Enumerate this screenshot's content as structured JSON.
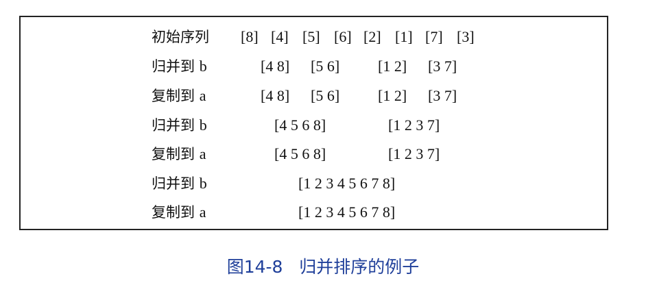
{
  "rows": [
    {
      "label": "初始序列",
      "label_latin": "",
      "groups": [
        "[8]",
        "[4]",
        "[5]",
        "[6]",
        "[2]",
        "[1]",
        "[7]",
        "[3]"
      ]
    },
    {
      "label": "归并到",
      "label_latin": "b",
      "groups": [
        "[4 8]",
        "[5 6]",
        "[1 2]",
        "[3 7]"
      ]
    },
    {
      "label": "复制到",
      "label_latin": "a",
      "groups": [
        "[4 8]",
        "[5 6]",
        "[1 2]",
        "[3 7]"
      ]
    },
    {
      "label": "归并到",
      "label_latin": "b",
      "groups": [
        "[4 5 6 8]",
        "[1 2 3 7]"
      ]
    },
    {
      "label": "复制到",
      "label_latin": "a",
      "groups": [
        "[4 5 6 8]",
        "[1 2 3 7]"
      ]
    },
    {
      "label": "归并到",
      "label_latin": "b",
      "groups": [
        "[1 2 3 4 5 6 7 8]"
      ]
    },
    {
      "label": "复制到",
      "label_latin": "a",
      "groups": [
        "[1 2 3 4 5 6 7 8]"
      ]
    }
  ],
  "caption": "图14-8   归并排序的例子"
}
